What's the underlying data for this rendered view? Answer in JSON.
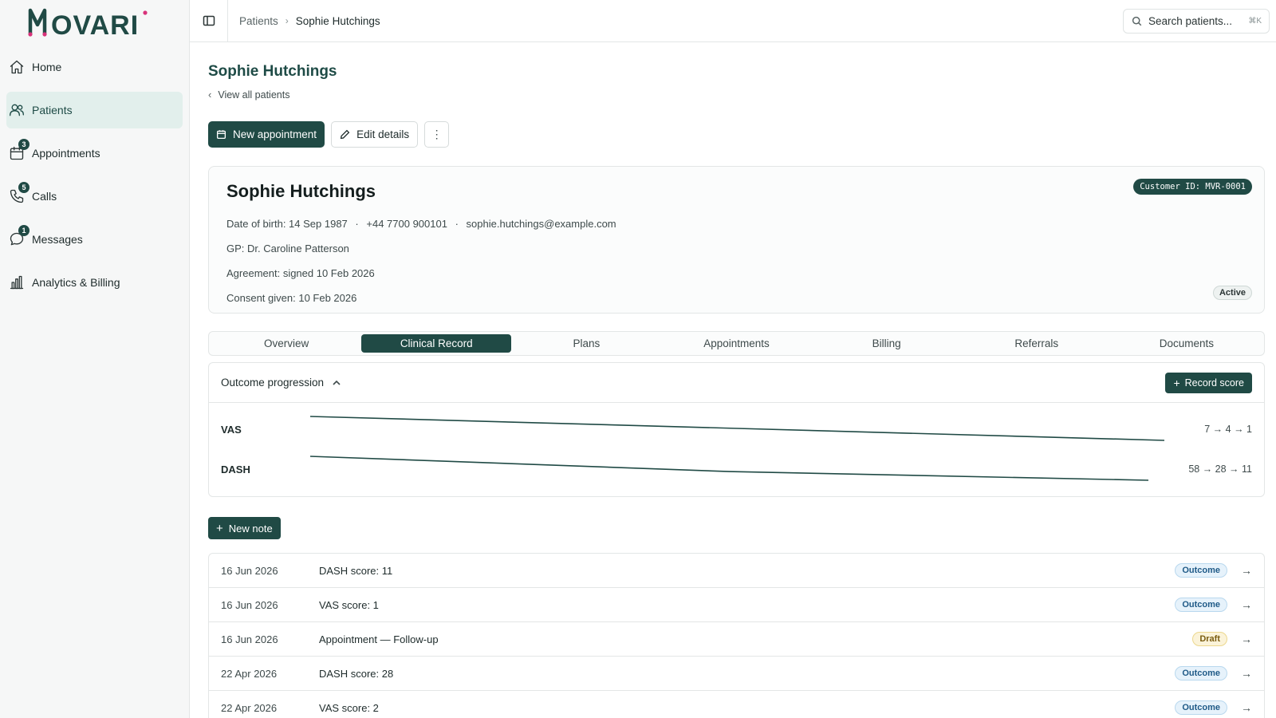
{
  "app": {
    "logo_text": "MOVARI"
  },
  "sidebar": {
    "items": [
      {
        "label": "Home",
        "icon": "home-icon",
        "badge": null,
        "active": false
      },
      {
        "label": "Patients",
        "icon": "users-icon",
        "badge": null,
        "active": true
      },
      {
        "label": "Appointments",
        "icon": "calendar-icon",
        "badge": "3",
        "active": false
      },
      {
        "label": "Calls",
        "icon": "phone-icon",
        "badge": "5",
        "active": false
      },
      {
        "label": "Messages",
        "icon": "message-icon",
        "badge": "1",
        "active": false
      },
      {
        "label": "Analytics & Billing",
        "icon": "chart-icon",
        "badge": null,
        "active": false
      }
    ]
  },
  "topbar": {
    "breadcrumb": {
      "parent": "Patients",
      "current": "Sophie Hutchings"
    },
    "search": {
      "placeholder": "Search patients...",
      "shortcut": "⌘K"
    }
  },
  "page": {
    "title": "Sophie Hutchings",
    "back_link": "View all patients",
    "actions": {
      "new_appointment": "New appointment",
      "edit_details": "Edit details",
      "more": "⋮"
    }
  },
  "patient": {
    "name": "Sophie Hutchings",
    "dob": "Date of birth: 14 Sep 1987",
    "phone": "+44 7700 900101",
    "email": "sophie.hutchings@example.com",
    "gp": "GP: Dr. Caroline Patterson",
    "agreement": "Agreement: signed 10 Feb 2026",
    "consent": "Consent given: 10 Feb 2026",
    "customer_id": "Customer ID: MVR-0001",
    "status": "Active",
    "separator": "·"
  },
  "tabs": [
    {
      "label": "Overview",
      "active": false
    },
    {
      "label": "Clinical Record",
      "active": true
    },
    {
      "label": "Plans",
      "active": false
    },
    {
      "label": "Appointments",
      "active": false
    },
    {
      "label": "Billing",
      "active": false
    },
    {
      "label": "Referrals",
      "active": false
    },
    {
      "label": "Documents",
      "active": false
    }
  ],
  "outcomes": {
    "title": "Outcome progression",
    "record_button": "Record score",
    "metrics": [
      {
        "label": "VAS",
        "values": [
          7,
          4,
          1
        ],
        "sequence": "7 → 4 → 1",
        "color": "#204a45"
      },
      {
        "label": "DASH",
        "values": [
          58,
          28,
          11
        ],
        "sequence": "58 → 28 → 11",
        "color": "#204a45"
      }
    ]
  },
  "notes": {
    "new_button": "New note",
    "rows": [
      {
        "date": "16 Jun 2026",
        "title": "DASH score: 11",
        "tag": "Outcome",
        "tag_type": "outcome"
      },
      {
        "date": "16 Jun 2026",
        "title": "VAS score: 1",
        "tag": "Outcome",
        "tag_type": "outcome"
      },
      {
        "date": "16 Jun 2026",
        "title": "Appointment — Follow-up",
        "tag": "Draft",
        "tag_type": "draft"
      },
      {
        "date": "22 Apr 2026",
        "title": "DASH score: 28",
        "tag": "Outcome",
        "tag_type": "outcome"
      },
      {
        "date": "22 Apr 2026",
        "title": "VAS score: 2",
        "tag": "Outcome",
        "tag_type": "outcome"
      }
    ],
    "arrow": "→"
  },
  "colors": {
    "brand": "#204a45",
    "brand_soft": "#e2efec",
    "logo_accent": "#d8327a"
  }
}
